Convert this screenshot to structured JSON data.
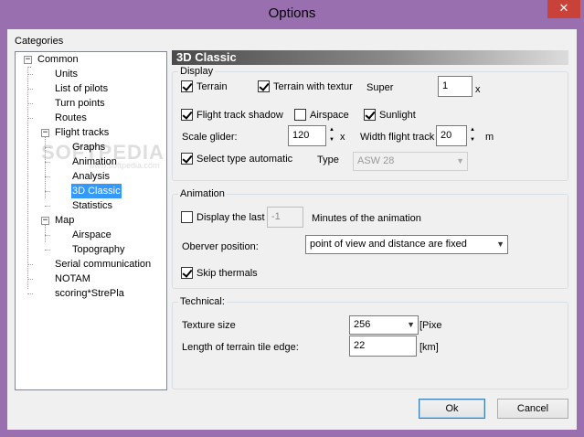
{
  "window": {
    "title": "Options",
    "close": "✕"
  },
  "categories_label": "Categories",
  "tree": {
    "common": "Common",
    "units": "Units",
    "list_of_pilots": "List of pilots",
    "turn_points": "Turn points",
    "routes": "Routes",
    "flight_tracks": "Flight tracks",
    "graphs": "Graphs",
    "animation": "Animation",
    "analysis": "Analysis",
    "classic3d": "3D Classic",
    "statistics": "Statistics",
    "map": "Map",
    "airspace": "Airspace",
    "topography": "Topography",
    "serial_communication": "Serial communication",
    "notam": "NOTAM",
    "scoring": "scoring*StrePla",
    "collapse_glyph": "−"
  },
  "watermark": {
    "main": "SOFTPEDIA",
    "sub": "www.softpedia.com"
  },
  "panel_title": "3D Classic",
  "display": {
    "label": "Display",
    "terrain": "Terrain",
    "terrain_with_texture": "Terrain with textur",
    "super_label": "Super",
    "super_value": "1",
    "super_unit": "x",
    "flight_track_shadow": "Flight track shadow",
    "airspace": "Airspace",
    "sunlight": "Sunlight",
    "scale_glider_label": "Scale glider:",
    "scale_glider_value": "120",
    "scale_glider_unit": "x",
    "width_flight_track_label": "Width flight track",
    "width_flight_track_value": "20",
    "width_unit": "m",
    "select_type_automatic": "Select type automatic",
    "type_label": "Type",
    "type_value": "ASW 28"
  },
  "animation": {
    "label": "Animation",
    "display_the_last": "Display the last",
    "last_value": "-1",
    "minutes_label": "Minutes of the animation",
    "observer_label": "Oberver position:",
    "observer_value": "point of view and distance are fixed",
    "skip_thermals": "Skip thermals"
  },
  "technical": {
    "label": "Technical:",
    "texture_size_label": "Texture size",
    "texture_size_value": "256",
    "texture_unit": "[Pixe",
    "tile_edge_label": "Length of terrain tile edge:",
    "tile_edge_value": "22",
    "tile_unit": "[km]"
  },
  "buttons": {
    "ok": "Ok",
    "cancel": "Cancel"
  },
  "glyphs": {
    "dropdown": "▼",
    "spin_up": "▲",
    "spin_down": "▼"
  },
  "checkbox_state": {
    "terrain": true,
    "terrain_with_texture": true,
    "flight_track_shadow": true,
    "airspace": false,
    "sunlight": true,
    "select_type_automatic": true,
    "display_the_last": false,
    "skip_thermals": true
  }
}
